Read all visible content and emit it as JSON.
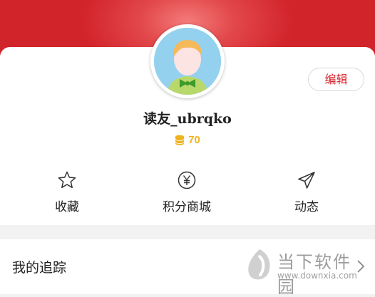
{
  "profile": {
    "edit_label": "编辑",
    "username": "读友_ubrqko",
    "points": "70"
  },
  "actions": [
    {
      "label": "收藏",
      "icon": "star-icon"
    },
    {
      "label": "积分商城",
      "icon": "yen-circle-icon"
    },
    {
      "label": "动态",
      "icon": "paper-plane-icon"
    }
  ],
  "following": {
    "title": "我的追踪",
    "icon": "chevron-right-icon"
  },
  "watermark": {
    "brand": "当下软件园",
    "url": "www.downxia.com"
  },
  "colors": {
    "brand_red": "#d1232a",
    "coin_gold": "#f0b21e",
    "avatar_bg": "#94d1ef"
  }
}
